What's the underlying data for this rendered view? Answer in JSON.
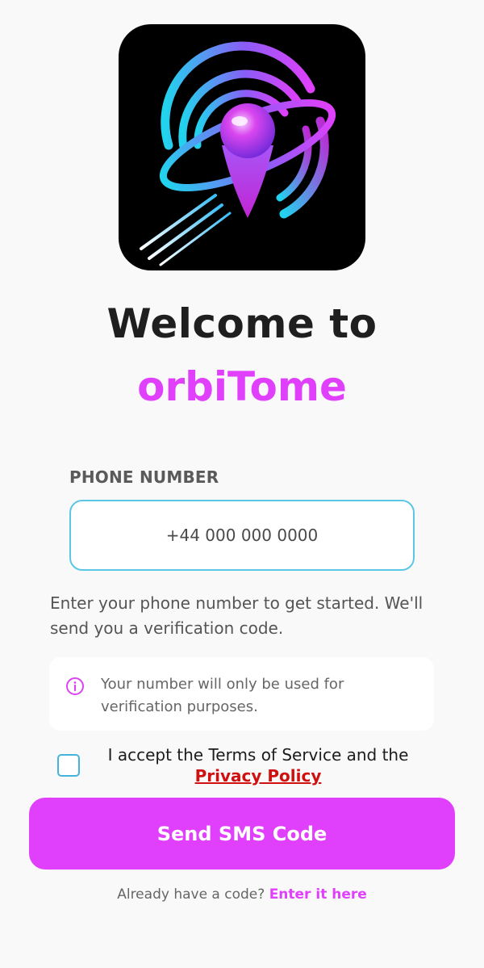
{
  "header": {
    "welcome_text": "Welcome to",
    "brand_name": "orbiTome"
  },
  "phone": {
    "label": "PHONE NUMBER",
    "placeholder": "+44 000 000 0000"
  },
  "description": "Enter your phone number to get started. We'll send you a verification code.",
  "notice": {
    "icon": "info-icon",
    "text": "Your number will only be used for verification purposes."
  },
  "terms": {
    "prefix": "I accept the Terms of Service and the",
    "link": "Privacy Policy",
    "checked": false
  },
  "actions": {
    "send_label": "Send SMS Code"
  },
  "footer": {
    "prompt": "Already have a code?",
    "link": "Enter it here"
  },
  "colors": {
    "accent": "#e040fb",
    "input_border": "#5bc7e4",
    "checkbox_border": "#44b4dd",
    "link_red": "#d01010",
    "background": "#f9f9f9"
  }
}
